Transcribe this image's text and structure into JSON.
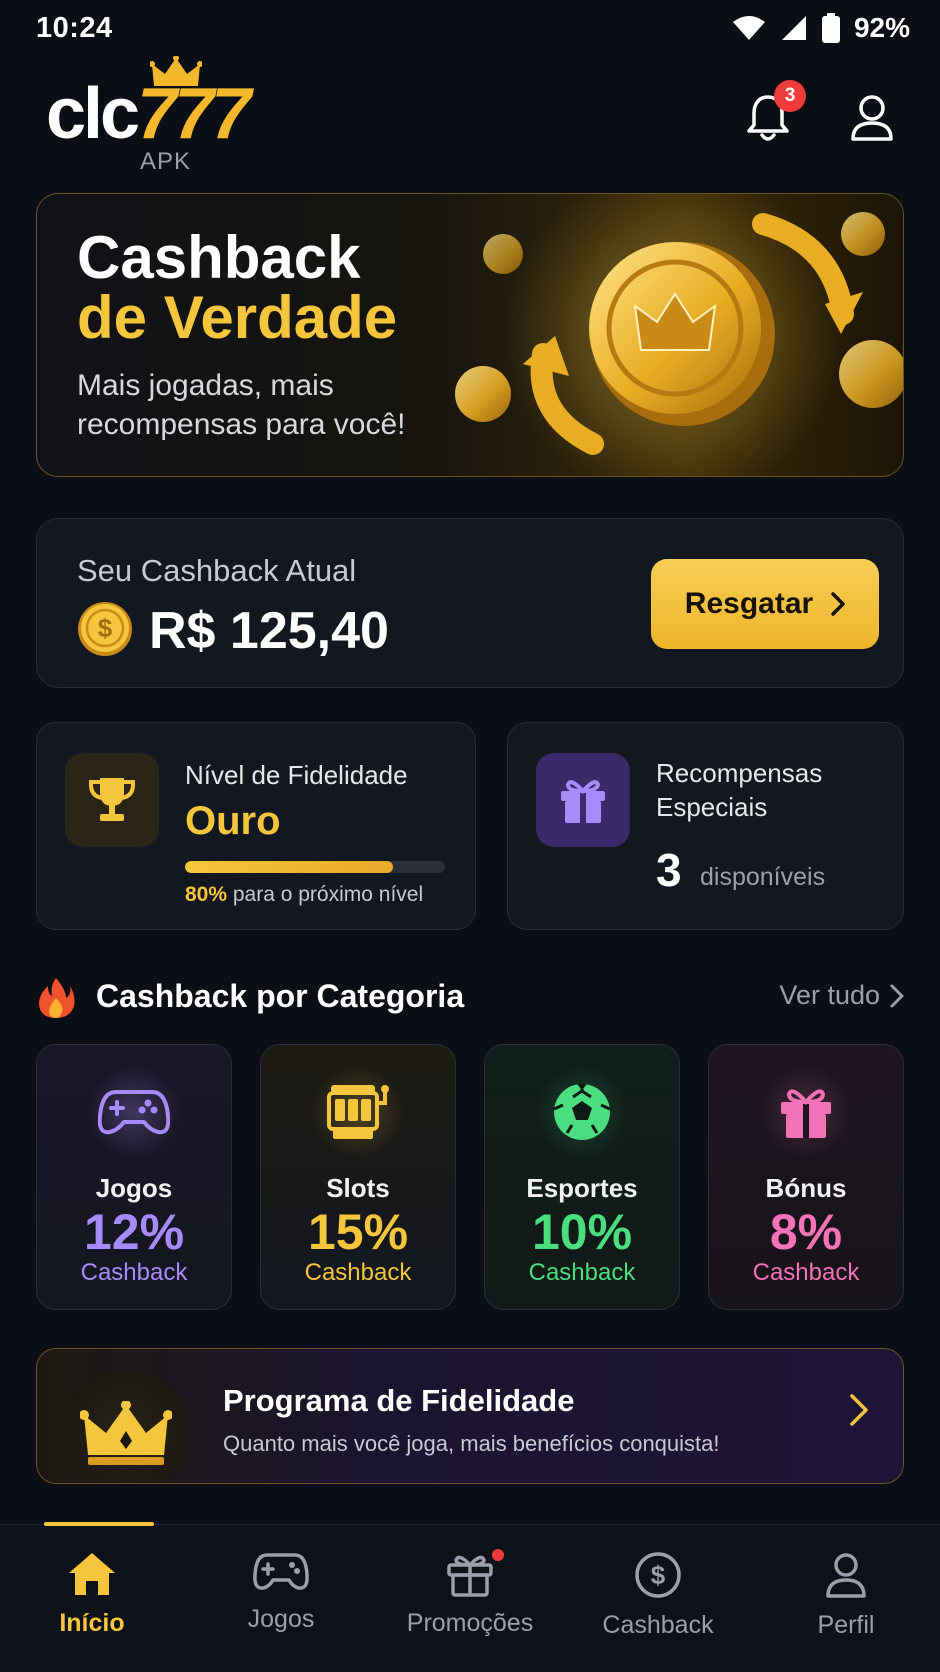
{
  "status_bar": {
    "time": "10:24",
    "battery": "92%"
  },
  "header": {
    "logo_text": "clc",
    "logo_numbers": "777",
    "logo_sub": "APK",
    "notification_count": "3"
  },
  "hero": {
    "title_line1": "Cashback",
    "title_line2": "de Verdade",
    "subtitle": "Mais jogadas, mais recompensas para você!"
  },
  "balance": {
    "label": "Seu Cashback Atual",
    "amount": "R$ 125,40",
    "redeem_label": "Resgatar"
  },
  "loyalty_card": {
    "title": "Nível de Fidelidade",
    "level": "Ouro",
    "progress": 0.8,
    "progress_pct": "80%",
    "progress_note": "para o próximo nível"
  },
  "rewards_card": {
    "title": "Recompensas Especiais",
    "count": "3",
    "count_label": "disponíveis"
  },
  "category_section": {
    "title": "Cashback por Categoria",
    "see_all": "Ver tudo"
  },
  "categories": [
    {
      "name": "Jogos",
      "percent": "12%",
      "label": "Cashback",
      "color": "#a78bfa",
      "icon": "gamepad-icon"
    },
    {
      "name": "Slots",
      "percent": "15%",
      "label": "Cashback",
      "color": "#f5c63c",
      "icon": "slot-machine-icon"
    },
    {
      "name": "Esportes",
      "percent": "10%",
      "label": "Cashback",
      "color": "#4ade80",
      "icon": "soccer-ball-icon"
    },
    {
      "name": "Bónus",
      "percent": "8%",
      "label": "Cashback",
      "color": "#f472b6",
      "icon": "gift-icon"
    }
  ],
  "loyalty_program": {
    "title": "Programa de Fidelidade",
    "subtitle": "Quanto mais você joga, mais benefícios conquista!"
  },
  "bottom_nav": [
    {
      "label": "Início",
      "icon": "home-icon",
      "active": true
    },
    {
      "label": "Jogos",
      "icon": "gamepad-icon",
      "active": false
    },
    {
      "label": "Promoções",
      "icon": "gift-icon",
      "active": false
    },
    {
      "label": "Cashback",
      "icon": "dollar-circle-icon",
      "active": false
    },
    {
      "label": "Perfil",
      "icon": "user-icon",
      "active": false
    }
  ],
  "colors": {
    "background": "#0b0e14",
    "accent": "#f5c63c",
    "card": "#131720"
  }
}
